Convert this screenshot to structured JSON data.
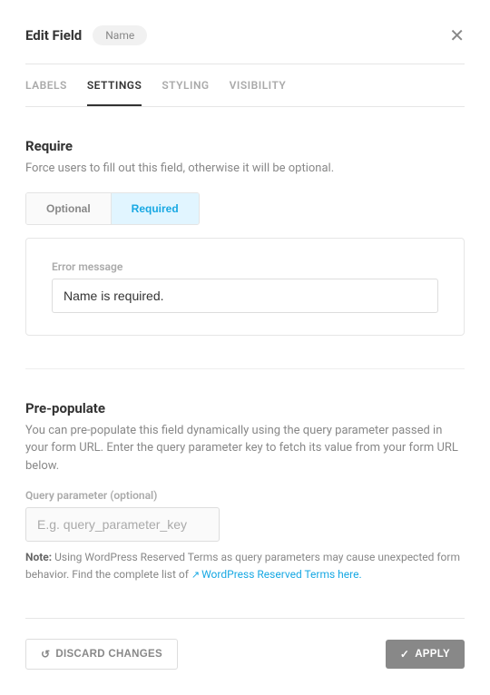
{
  "header": {
    "title": "Edit Field",
    "chip": "Name"
  },
  "tabs": [
    "LABELS",
    "SETTINGS",
    "STYLING",
    "VISIBILITY"
  ],
  "active_tab": "SETTINGS",
  "require": {
    "heading": "Require",
    "desc": "Force users to fill out this field, otherwise it will be optional.",
    "options": {
      "optional": "Optional",
      "required": "Required"
    },
    "error_label": "Error message",
    "error_value": "Name is required."
  },
  "prepopulate": {
    "heading": "Pre-populate",
    "desc": "You can pre-populate this field dynamically using the query parameter passed in your form URL. Enter the query parameter key to fetch its value from your form URL below.",
    "qp_label": "Query parameter (optional)",
    "qp_placeholder": "E.g. query_parameter_key",
    "note_bold": "Note:",
    "note_text": " Using WordPress Reserved Terms as query parameters may cause unexpected form behavior. Find the complete list of ",
    "note_link": "WordPress Reserved Terms here"
  },
  "footer": {
    "discard": "DISCARD CHANGES",
    "apply": "APPLY"
  }
}
